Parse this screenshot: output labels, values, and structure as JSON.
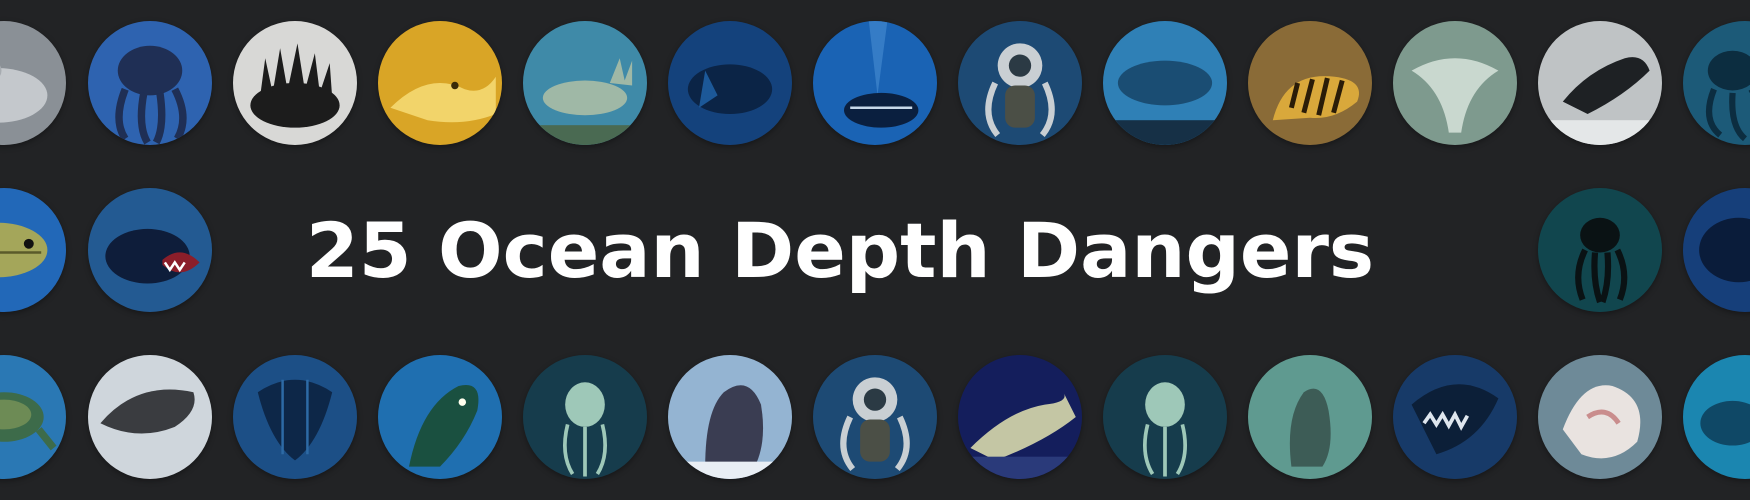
{
  "banner": {
    "title": "25 Ocean Depth Dangers"
  },
  "colors": {
    "background": "#222325",
    "title": "#ffffff"
  },
  "thumbnails": [
    {
      "subject": "pale-leviathan",
      "bg": "#8a9096",
      "fg": "#c4c8cc"
    },
    {
      "subject": "tentacled-octopus-beast",
      "bg": "#2e63b0",
      "fg": "#1f2f55"
    },
    {
      "subject": "spiny-black-creature",
      "bg": "#d8d8d6",
      "fg": "#1c1c1c"
    },
    {
      "subject": "golden-eel",
      "bg": "#d9a526",
      "fg": "#f2d46a"
    },
    {
      "subject": "pale-green-sea-lizard",
      "bg": "#3f8aa8",
      "fg": "#9fb8a6"
    },
    {
      "subject": "blue-shadow-shark",
      "bg": "#14427c",
      "fg": "#0b2446"
    },
    {
      "subject": "abyss-submarine-creature",
      "bg": "#1a63b4",
      "fg": "#0a1f3f"
    },
    {
      "subject": "deep-sea-diver",
      "bg": "#1d4a74",
      "fg": "#c9cfd3"
    },
    {
      "subject": "giant-whale-silhouette",
      "bg": "#2f80b6",
      "fg": "#1a4d73"
    },
    {
      "subject": "striped-sea-snake",
      "bg": "#8a6b37",
      "fg": "#d9a83b"
    },
    {
      "subject": "ghostly-manta-creature",
      "bg": "#7e9a8e",
      "fg": "#c9d8cf"
    },
    {
      "subject": "dark-whale-storm",
      "bg": "#bfc3c5",
      "fg": "#1e2124"
    },
    {
      "subject": "teal-kraken",
      "bg": "#1c5a78",
      "fg": "#0c2d40"
    },
    {
      "subject": "armored-fish",
      "bg": "#2268b8",
      "fg": "#a4a65a"
    },
    {
      "subject": "fanged-anglerfish",
      "bg": "#235a92",
      "fg": "#0e1d3a"
    },
    {
      "subject": "dark-octopus",
      "bg": "#11464e",
      "fg": "#0a1214"
    },
    {
      "subject": "deep-blue-leviathan",
      "bg": "#163f7a",
      "fg": "#0a1c3a"
    },
    {
      "subject": "green-sea-turtle",
      "bg": "#2a78b4",
      "fg": "#3d6b4a"
    },
    {
      "subject": "grey-whale",
      "bg": "#cfd6dc",
      "fg": "#3a3c40"
    },
    {
      "subject": "sunken-wreck-creature",
      "bg": "#1c4f86",
      "fg": "#0d2748"
    },
    {
      "subject": "toothed-serpent",
      "bg": "#1f6fb0",
      "fg": "#1a5040"
    },
    {
      "subject": "glowing-ghost-diver",
      "bg": "#163c4c",
      "fg": "#9ec8b8"
    },
    {
      "subject": "surfacing-whale-tail",
      "bg": "#94b4d2",
      "fg": "#3a3d52"
    },
    {
      "subject": "deep-sea-diver-2",
      "bg": "#1d4a74",
      "fg": "#c9cfd3"
    },
    {
      "subject": "pale-reef-creature",
      "bg": "#141e5c",
      "fg": "#c4c6a4"
    },
    {
      "subject": "glowing-ghost-diver-2",
      "bg": "#163c4c",
      "fg": "#9ec8b8"
    },
    {
      "subject": "murky-seal",
      "bg": "#5f9a90",
      "fg": "#3d5c56"
    },
    {
      "subject": "shark-jaws",
      "bg": "#173a68",
      "fg": "#dfe6ee"
    },
    {
      "subject": "white-coral-shell",
      "bg": "#6e8a98",
      "fg": "#e9e3e0"
    },
    {
      "subject": "teal-swimmer",
      "bg": "#1b86b0",
      "fg": "#0f4866"
    }
  ]
}
